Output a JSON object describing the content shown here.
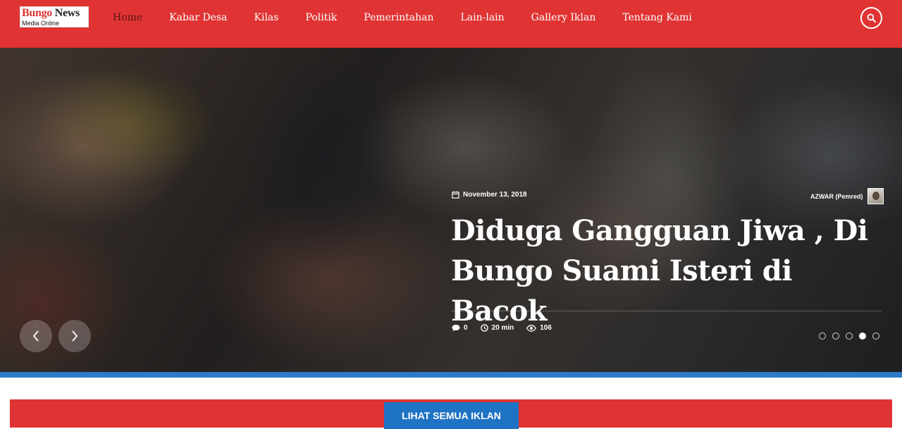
{
  "header": {
    "logo": {
      "brand_part1": "Bungo",
      "brand_part2": "News",
      "tagline": "Media Online"
    },
    "nav": [
      {
        "label": "Home",
        "active": true
      },
      {
        "label": "Kabar Desa"
      },
      {
        "label": "Kilas"
      },
      {
        "label": "Politik"
      },
      {
        "label": "Pemerintahan"
      },
      {
        "label": "Lain-lain"
      },
      {
        "label": "Gallery Iklan"
      },
      {
        "label": "Tentang Kami"
      }
    ],
    "search_icon": "search-icon"
  },
  "slider": {
    "date": "November 13, 2018",
    "author": "AZWAR (Pemred)",
    "headline": "Diduga Gangguan Jiwa , Di Bungo Suami Isteri di Bacok",
    "comments": "0",
    "read_time": "20 min",
    "views": "106",
    "dots_count": 5,
    "active_dot": 4
  },
  "ad": {
    "button_label": "LIHAT SEMUA IKLAN"
  },
  "colors": {
    "header_red": "#e03333",
    "accent_blue": "#2d7ac9",
    "button_blue": "#1f73c4"
  }
}
